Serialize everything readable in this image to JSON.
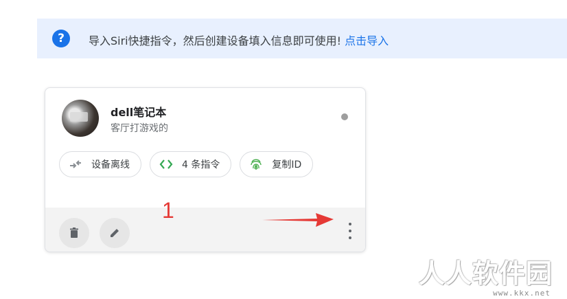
{
  "notice": {
    "icon": "help-circle-icon",
    "text": "导入Siri快捷指令，然后创建设备填入信息即可使用!",
    "link": "点击导入"
  },
  "device": {
    "name": "dell笔记本",
    "description": "客厅打游戏的",
    "status_color": "#9e9e9e",
    "chips": [
      {
        "icon": "offline-arrows-icon",
        "label": "设备离线"
      },
      {
        "icon": "code-icon",
        "label": "4 条指令"
      },
      {
        "icon": "fingerprint-icon",
        "label": "复制ID"
      }
    ]
  },
  "annotation": {
    "number": "1",
    "color": "#e53935"
  },
  "watermark": {
    "title": "人人软件园",
    "url": "www.kkx.net"
  },
  "colors": {
    "accent": "#1a73e8",
    "notice_bg": "#e8f0fe",
    "code_green": "#34a853"
  }
}
